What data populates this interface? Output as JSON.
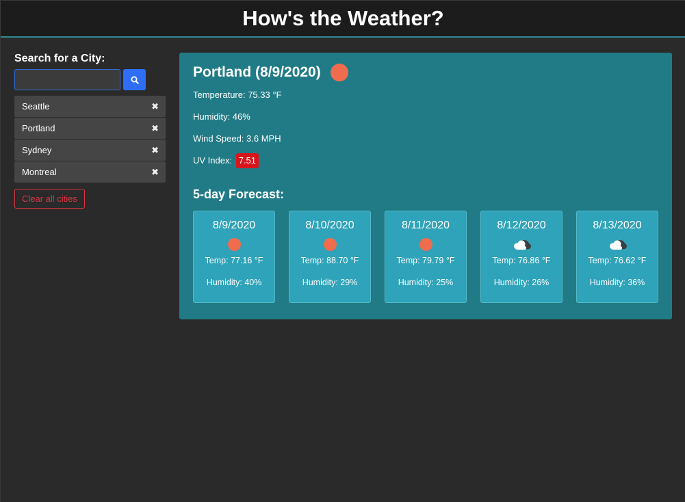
{
  "header": {
    "title": "How's the Weather?"
  },
  "sidebar": {
    "search_label": "Search for a City:",
    "search": {
      "value": "",
      "placeholder": ""
    },
    "search_icon": "search-icon",
    "cities": [
      {
        "name": "Seattle"
      },
      {
        "name": "Portland"
      },
      {
        "name": "Sydney"
      },
      {
        "name": "Montreal"
      }
    ],
    "remove_glyph": "✖",
    "clear_label": "Clear all cities"
  },
  "current": {
    "title": "Portland (8/9/2020)",
    "icon": "sun-icon",
    "temperature": "Temperature: 75.33 °F",
    "humidity": "Humidity: 46%",
    "wind": "Wind Speed: 3.6 MPH",
    "uv_label": "UV Index:",
    "uv_value": "7.51"
  },
  "forecast": {
    "heading": "5-day Forecast:",
    "days": [
      {
        "date": "8/9/2020",
        "icon": "sun-icon",
        "temp": "Temp: 77.16 °F",
        "humidity": "Humidity: 40%"
      },
      {
        "date": "8/10/2020",
        "icon": "sun-icon",
        "temp": "Temp: 88.70 °F",
        "humidity": "Humidity: 29%"
      },
      {
        "date": "8/11/2020",
        "icon": "sun-icon",
        "temp": "Temp: 79.79 °F",
        "humidity": "Humidity: 25%"
      },
      {
        "date": "8/12/2020",
        "icon": "cloud-icon",
        "temp": "Temp: 76.86 °F",
        "humidity": "Humidity: 26%"
      },
      {
        "date": "8/13/2020",
        "icon": "cloud-icon",
        "temp": "Temp: 76.62 °F",
        "humidity": "Humidity: 36%"
      }
    ]
  },
  "colors": {
    "background": "#2a2a2a",
    "header": "#1c1c1c",
    "panel": "#217b86",
    "card": "#2ea3b9",
    "sun": "#ef6c4e",
    "uv_badge": "#d9151c",
    "search_button": "#2d6ef5",
    "danger": "#dc3545"
  }
}
